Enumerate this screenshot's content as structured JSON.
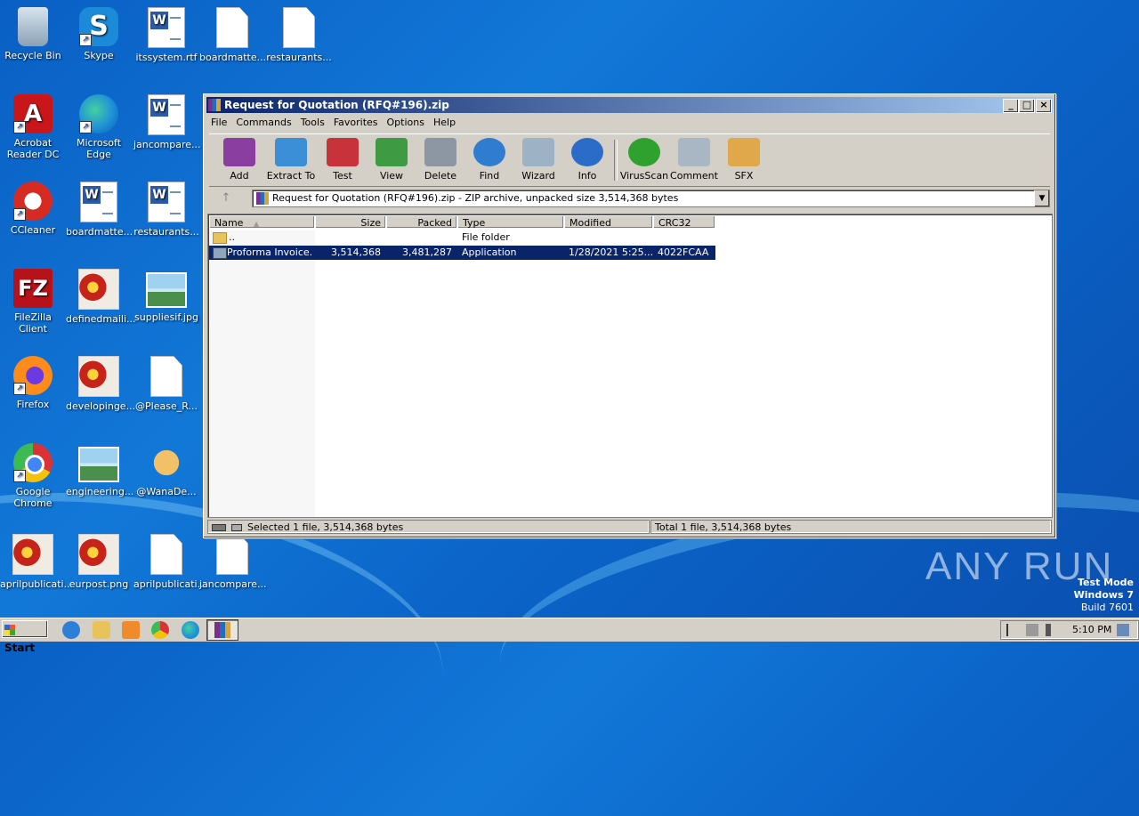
{
  "desktop": {
    "icons": [
      {
        "label": "Recycle Bin"
      },
      {
        "label": "Skype"
      },
      {
        "label": "itssystem.rtf"
      },
      {
        "label": "boardmatte..."
      },
      {
        "label": "restaurants..."
      },
      {
        "label": "Acrobat Reader DC"
      },
      {
        "label": "Microsoft Edge"
      },
      {
        "label": "jancompare..."
      },
      {
        "label": "CCleaner"
      },
      {
        "label": "boardmatte..."
      },
      {
        "label": "restaurants..."
      },
      {
        "label": "FileZilla Client"
      },
      {
        "label": "definedmaili..."
      },
      {
        "label": "suppliesif.jpg"
      },
      {
        "label": "Firefox"
      },
      {
        "label": "developinge..."
      },
      {
        "label": "@Please_R..."
      },
      {
        "label": "Google Chrome"
      },
      {
        "label": "engineering..."
      },
      {
        "label": "@WanaDe..."
      },
      {
        "label": "aprilpublicati..."
      },
      {
        "label": "eurpost.png"
      },
      {
        "label": "aprilpublicati..."
      },
      {
        "label": "jancompare..."
      }
    ],
    "watermark": "ANY RUN",
    "test_mode": {
      "line1": "Test Mode",
      "line2": "Windows 7",
      "line3": "Build 7601"
    }
  },
  "window": {
    "title": "Request for Quotation (RFQ#196).zip",
    "controls": {
      "minimize": "_",
      "maximize": "□",
      "close": "×"
    },
    "menu": [
      "File",
      "Commands",
      "Tools",
      "Favorites",
      "Options",
      "Help"
    ],
    "toolbar": [
      {
        "label": "Add",
        "icon": "add-icon",
        "color": "#8a3ea0"
      },
      {
        "label": "Extract To",
        "icon": "extract-folder-icon",
        "color": "#3b8fd6"
      },
      {
        "label": "Test",
        "icon": "test-checklist-icon",
        "color": "#c8323a"
      },
      {
        "label": "View",
        "icon": "view-book-icon",
        "color": "#3f9a44"
      },
      {
        "label": "Delete",
        "icon": "trash-icon",
        "color": "#8c97a3"
      },
      {
        "label": "Find",
        "icon": "magnifier-icon",
        "color": "#2f7cd0"
      },
      {
        "label": "Wizard",
        "icon": "wand-icon",
        "color": "#9db2c4"
      },
      {
        "label": "Info",
        "icon": "info-icon",
        "color": "#2a6cc8"
      },
      {
        "label": "VirusScan",
        "icon": "virus-icon",
        "color": "#2fa12f"
      },
      {
        "label": "Comment",
        "icon": "comment-icon",
        "color": "#a9b6c4"
      },
      {
        "label": "SFX",
        "icon": "sfx-box-icon",
        "color": "#e0a84a"
      }
    ],
    "address": {
      "up_arrow": "↑",
      "text": "Request for Quotation (RFQ#196).zip - ZIP archive, unpacked size 3,514,368 bytes",
      "dropdown": "▼"
    },
    "columns": {
      "name": "Name",
      "sort": "▲",
      "size": "Size",
      "packed": "Packed",
      "type": "Type",
      "modified": "Modified",
      "crc": "CRC32"
    },
    "rows": [
      {
        "name": "..",
        "size": "",
        "packed": "",
        "type": "File folder",
        "modified": "",
        "crc": ""
      },
      {
        "name": "Proforma Invoice...",
        "size": "3,514,368",
        "packed": "3,481,287",
        "type": "Application",
        "modified": "1/28/2021 5:25...",
        "crc": "4022FCAA"
      }
    ],
    "status": {
      "left": "Selected 1 file, 3,514,368 bytes",
      "right": "Total 1 file, 3,514,368 bytes"
    }
  },
  "taskbar": {
    "start": "Start",
    "clock": "5:10 PM"
  }
}
